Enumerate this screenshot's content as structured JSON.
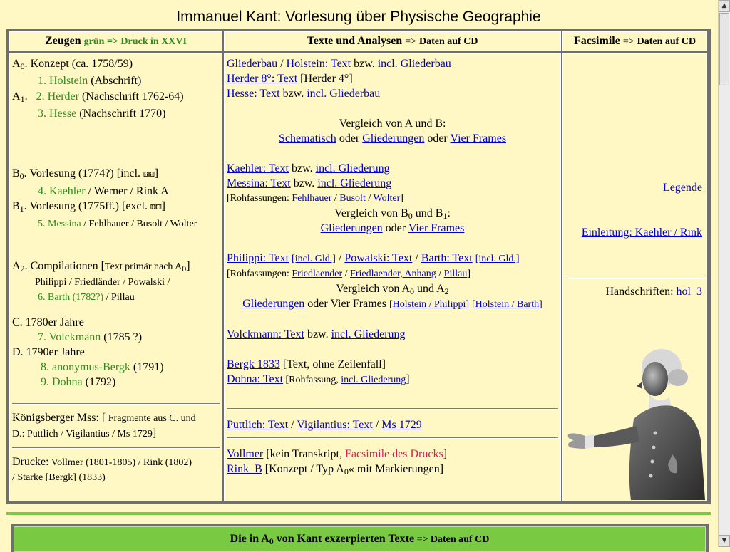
{
  "page": {
    "title": "Immanuel Kant: Vorlesung über Physische Geographie"
  },
  "headers": {
    "col1_main": "Zeugen",
    "col1_note": "grün => Druck in XXVI",
    "col2_main": "Texte und Analysen",
    "col2_arrow": "=>",
    "col2_note": "Daten auf CD",
    "col3_main": "Facsimile",
    "col3_arrow": "=>",
    "col3_note": "Daten auf CD"
  },
  "zeugen": {
    "a0": "A",
    "a0_sub": "0",
    "a0_text": ". Konzept (ca. 1758/59)",
    "holstein_num": "1. Holstein",
    "holstein_note": " (Abschrift)",
    "a1": "A",
    "a1_sub": "1",
    "a1_text": ".",
    "herder_num": "2. Herder",
    "herder_note": " (Nachschrift 1762-64)",
    "hesse_num": "3. Hesse",
    "hesse_note": " (Nachschrift 1770)",
    "b0": "B",
    "b0_sub": "0",
    "b0_text": ". Vorlesung (1774?) [incl.",
    "b0_glyph": "⚅⚅",
    "b0_close": "]",
    "kaehler_num": "4. Kaehler",
    "kaehler_rest": " / Werner / Rink A",
    "b1": "B",
    "b1_sub": "1",
    "b1_text": ". Vorlesung (1775ff.) [excl.",
    "b1_glyph": "⚅⚅",
    "b1_close": "]",
    "messina_num": "5. Messina",
    "messina_rest": " / Fehlhauer / Busolt / Wolter",
    "a2": "A",
    "a2_sub": "2",
    "a2_text": ". Compilationen [",
    "a2_small": "Text primär nach A",
    "a2_small_sub": "0",
    "a2_close": "]",
    "a2_list": "Philippi / Friedländer / Powalski /",
    "barth_num": "6. Barth (1782?)",
    "barth_rest": " / Pillau",
    "c_label": "C. 1780er Jahre",
    "volckmann_num": "7. Volckmann",
    "volckmann_note": " (1785 ?)",
    "d_label": "D. 1790er Jahre",
    "anonymus_num": "8. anonymus-Bergk",
    "anonymus_note": " (1791)",
    "dohna_num": "9. Dohna",
    "dohna_note": " (1792)",
    "koenigsberger": "Königsberger Mss: [",
    "koenigsberger_small": " Fragmente aus C. und",
    "koenigsberger_line2": "D.:  Puttlich / Vigilantius / Ms 1729",
    "koenigsberger_close": "]",
    "drucke": "Drucke:",
    "drucke_list": "  Vollmer (1801-1805) / Rink (1802)",
    "drucke_line2": "/ Starke [Bergk] (1833)"
  },
  "texte": {
    "gliederbau": "Gliederbau",
    "slash": " / ",
    "holstein_text": "Holstein: Text",
    "bzw": " bzw. ",
    "incl_gliederbau": "incl. Gliederbau",
    "herder8": "Herder 8°: Text",
    "herder4": "  [Herder 4°]",
    "hesse_text": "Hesse: Text",
    "incl_gliederbau2": "incl. Gliederbau",
    "vergleich_ab": "Vergleich von A und B:",
    "schematisch": "Schematisch",
    "oder": " oder ",
    "gliederungen": "Gliederungen",
    "vier_frames": "Vier Frames",
    "kaehler_text": "Kaehler: Text",
    "incl_gliederung": "incl. Gliederung",
    "messina_text": "Messina: Text",
    "incl_gliederung2": "incl. Gliederung",
    "rohfassungen": "[Rohfassungen: ",
    "fehlhauer": "Fehlhauer",
    "busolt": "Busolt",
    "wolter": "Wolter",
    "close_bracket": "]",
    "vergleich_b": "Vergleich von B",
    "vergleich_b_mid": " und B",
    "vergleich_b_end": ":",
    "gliederungen2": "Gliederungen",
    "vier_frames2": "Vier Frames",
    "philippi_text": "Philippi: Text",
    "incl_gld": "[incl. Gld.]",
    "powalski_text": "Powalski: Text",
    "barth_text": "Barth: Text",
    "incl_gld2": "[incl. Gld.]",
    "rohfassungen2": "[Rohfassungen: ",
    "friedlaender": "Friedlaender",
    "friedlaender_anhang": "Friedlaender, Anhang",
    "pillau": "Pillau",
    "vergleich_a": "Vergleich von A",
    "vergleich_a_mid": " und A",
    "gliederungen3": "Gliederungen",
    "oder_vier": " oder Vier Frames ",
    "holstein_philippi": "[Holstein / Philippi]",
    "holstein_barth": "[Holstein / Barth]",
    "volckmann_text": "Volckmann: Text",
    "incl_gliederung3": "incl. Gliederung",
    "bergk": "Bergk 1833",
    "bergk_note": " [Text, ohne Zeilenfall]",
    "dohna_text": "Dohna: Text",
    "dohna_pre": " [Rohfassung, ",
    "incl_gliederung4": "incl. Gliederung",
    "puttlich": "Puttlich: Text",
    "vigilantius": "Vigilantius: Text",
    "ms1729": "Ms 1729",
    "vollmer": "Vollmer",
    "vollmer_note": " [kein Transkript, ",
    "facsimile_drucks": "Facsimile des Drucks",
    "rink_b": "Rink_B",
    "rink_note": " [Konzept / Typ A",
    "rink_note_end": "« mit Markierungen]"
  },
  "facsimile": {
    "legende": "Legende",
    "einleitung": "Einleitung: Kaehler / Rink",
    "handschriften": "Handschriften: ",
    "hol3": "hol_3"
  },
  "bottom": {
    "title_pre": "Die in A",
    "title_sub": "0",
    "title_mid": " von Kant exzerpierten Texte",
    "arrow": " => ",
    "note": "Daten auf CD"
  },
  "colors": {
    "background": "#fff8c4",
    "frame": "#6f6f6f",
    "green_rule": "#7ac943",
    "link": "#0000cc",
    "green_text": "#2e8b1e",
    "red_text": "#cc2255"
  }
}
